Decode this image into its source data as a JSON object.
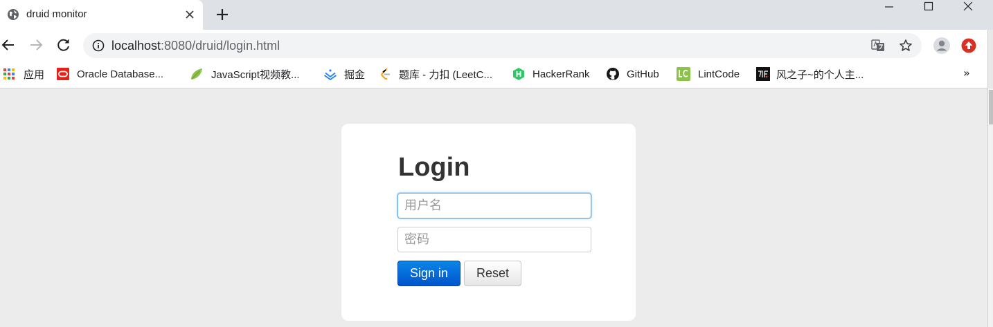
{
  "tab": {
    "title": "druid monitor"
  },
  "omnibox": {
    "url_host": "localhost",
    "url_rest": ":8080/druid/login.html"
  },
  "bookmarks": [
    {
      "label": "应用",
      "icon": "apps-grid-icon"
    },
    {
      "label": "Oracle Database...",
      "icon": "oracle-icon"
    },
    {
      "label": "JavaScript视频教...",
      "icon": "leaf-icon"
    },
    {
      "label": "掘金",
      "icon": "juejin-icon"
    },
    {
      "label": "题库 - 力扣 (LeetC...",
      "icon": "leetcode-icon"
    },
    {
      "label": "HackerRank",
      "icon": "hackerrank-icon"
    },
    {
      "label": "GitHub",
      "icon": "github-icon"
    },
    {
      "label": "LintCode",
      "icon": "lintcode-icon"
    },
    {
      "label": "风之子~的个人主...",
      "icon": "personal-site-icon"
    }
  ],
  "bookmarks_more": "»",
  "login": {
    "heading": "Login",
    "username_placeholder": "用户名",
    "password_placeholder": "密码",
    "signin_label": "Sign in",
    "reset_label": "Reset"
  },
  "colors": {
    "tabstrip": "#dee1e6",
    "page_bg": "#ececec",
    "primary_button": "#0066dd",
    "focus_ring": "#66afe9"
  }
}
